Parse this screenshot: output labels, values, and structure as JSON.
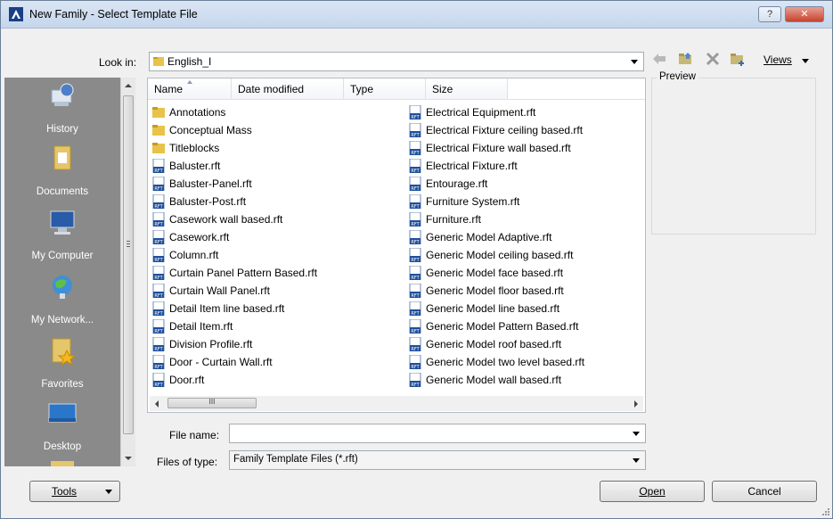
{
  "window": {
    "title": "New Family - Select Template File",
    "help_label": "?",
    "close_label": "✕"
  },
  "look_in": {
    "label": "Look in:",
    "value": "English_I"
  },
  "toolbar": {
    "views_label": "Views"
  },
  "places": [
    {
      "label": "History",
      "icon": "history-icon"
    },
    {
      "label": "Documents",
      "icon": "documents-icon"
    },
    {
      "label": "My Computer",
      "icon": "computer-icon"
    },
    {
      "label": "My Network...",
      "icon": "network-icon"
    },
    {
      "label": "Favorites",
      "icon": "favorites-icon"
    },
    {
      "label": "Desktop",
      "icon": "desktop-icon"
    }
  ],
  "columns": [
    "Name",
    "Date modified",
    "Type",
    "Size"
  ],
  "files_col1": [
    {
      "name": "Annotations",
      "kind": "folder"
    },
    {
      "name": "Conceptual Mass",
      "kind": "folder"
    },
    {
      "name": "Titleblocks",
      "kind": "folder"
    },
    {
      "name": "Baluster.rft",
      "kind": "rft"
    },
    {
      "name": "Baluster-Panel.rft",
      "kind": "rft"
    },
    {
      "name": "Baluster-Post.rft",
      "kind": "rft"
    },
    {
      "name": "Casework wall based.rft",
      "kind": "rft"
    },
    {
      "name": "Casework.rft",
      "kind": "rft"
    },
    {
      "name": "Column.rft",
      "kind": "rft"
    },
    {
      "name": "Curtain Panel Pattern Based.rft",
      "kind": "rft"
    },
    {
      "name": "Curtain Wall Panel.rft",
      "kind": "rft"
    },
    {
      "name": "Detail Item line based.rft",
      "kind": "rft"
    },
    {
      "name": "Detail Item.rft",
      "kind": "rft"
    },
    {
      "name": "Division Profile.rft",
      "kind": "rft"
    },
    {
      "name": "Door - Curtain Wall.rft",
      "kind": "rft"
    },
    {
      "name": "Door.rft",
      "kind": "rft"
    }
  ],
  "files_col2": [
    {
      "name": "Electrical Equipment.rft",
      "kind": "rft"
    },
    {
      "name": "Electrical Fixture ceiling based.rft",
      "kind": "rft"
    },
    {
      "name": "Electrical Fixture wall based.rft",
      "kind": "rft"
    },
    {
      "name": "Electrical Fixture.rft",
      "kind": "rft"
    },
    {
      "name": "Entourage.rft",
      "kind": "rft"
    },
    {
      "name": "Furniture System.rft",
      "kind": "rft"
    },
    {
      "name": "Furniture.rft",
      "kind": "rft"
    },
    {
      "name": "Generic Model Adaptive.rft",
      "kind": "rft"
    },
    {
      "name": "Generic Model ceiling based.rft",
      "kind": "rft"
    },
    {
      "name": "Generic Model face based.rft",
      "kind": "rft"
    },
    {
      "name": "Generic Model floor based.rft",
      "kind": "rft"
    },
    {
      "name": "Generic Model line based.rft",
      "kind": "rft"
    },
    {
      "name": "Generic Model Pattern Based.rft",
      "kind": "rft"
    },
    {
      "name": "Generic Model roof based.rft",
      "kind": "rft"
    },
    {
      "name": "Generic Model two level based.rft",
      "kind": "rft"
    },
    {
      "name": "Generic Model wall based.rft",
      "kind": "rft"
    }
  ],
  "hscroll_grip": "III",
  "preview": {
    "label": "Preview"
  },
  "file_name": {
    "label": "File name:",
    "value": ""
  },
  "file_type": {
    "label": "Files of type:",
    "value": "Family Template Files  (*.rft)"
  },
  "buttons": {
    "tools": "Tools",
    "open": "Open",
    "cancel": "Cancel"
  },
  "colors": {
    "places_bg": "#8a8a8a",
    "rft_icon_blue": "#1f4f9c",
    "folder_yellow": "#e8c34a"
  }
}
